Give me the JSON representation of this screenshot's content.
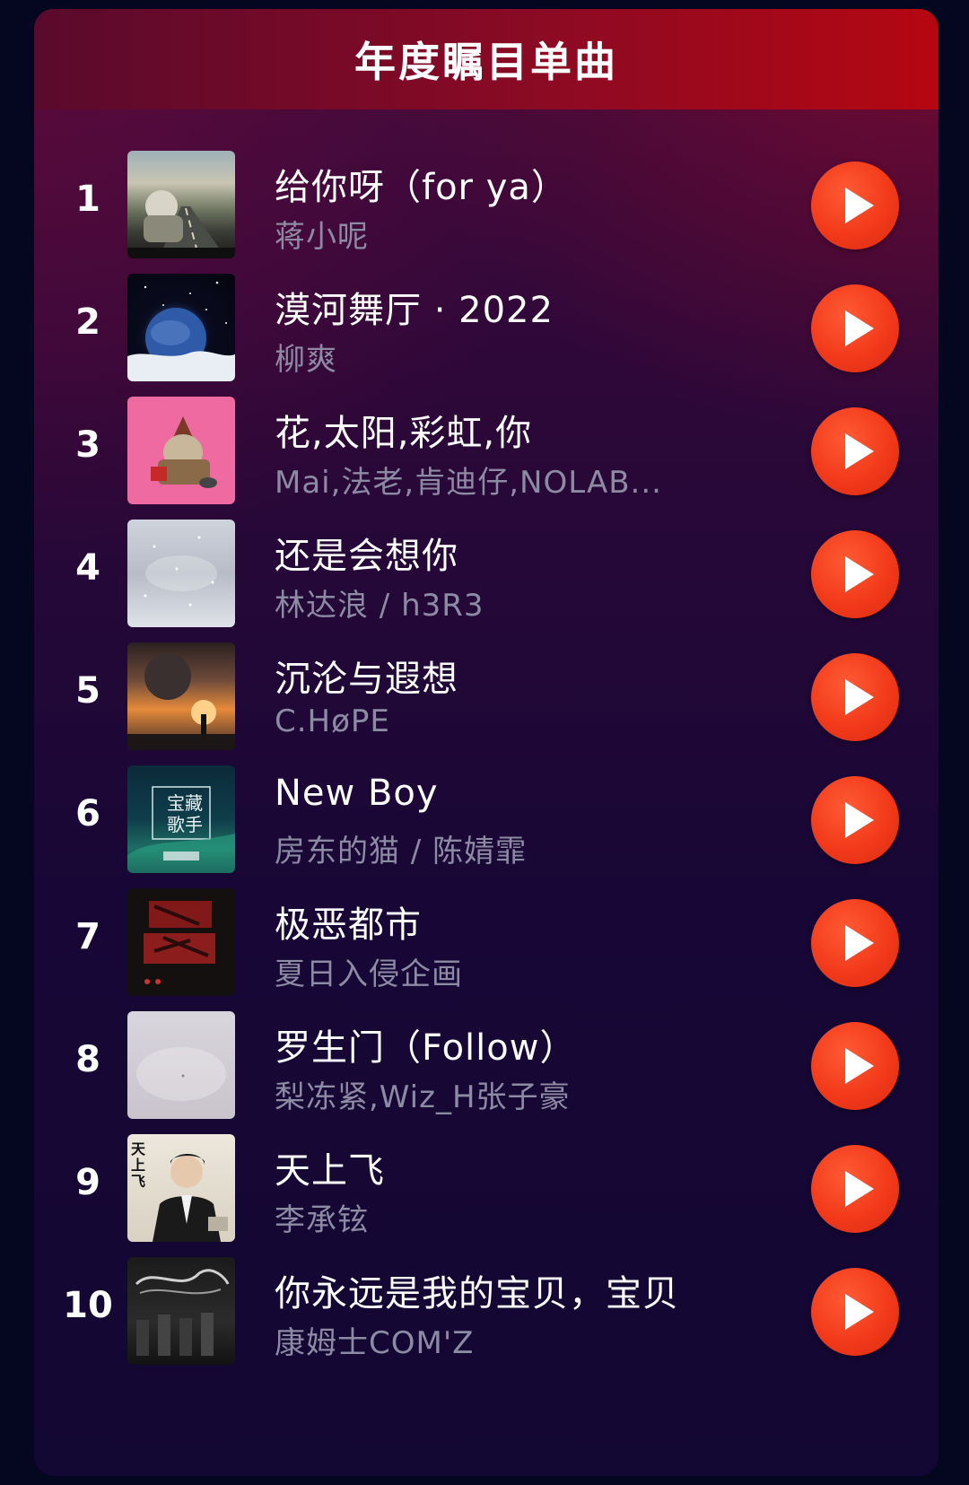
{
  "header": {
    "title": "年度瞩目单曲"
  },
  "accent": {
    "play_button": "#f23a1a",
    "header_gradient_end": "#b50712",
    "card_background": "#2a0838"
  },
  "songs": [
    {
      "rank": "1",
      "title": "给你呀（for ya）",
      "artist": "蒋小呢",
      "cover_icon": "road-scene-cover"
    },
    {
      "rank": "2",
      "title": "漠河舞厅 · 2022",
      "artist": "柳爽",
      "cover_icon": "planet-cover"
    },
    {
      "rank": "3",
      "title": "花,太阳,彩虹,你",
      "artist": "Mai,法老,肯迪仔,NOLAB...",
      "cover_icon": "pink-character-cover"
    },
    {
      "rank": "4",
      "title": "还是会想你",
      "artist": "林达浪 / h3R3",
      "cover_icon": "snowy-sky-cover"
    },
    {
      "rank": "5",
      "title": "沉沦与遐想",
      "artist": "C.HøPE",
      "cover_icon": "sunset-figure-cover"
    },
    {
      "rank": "6",
      "title": "New Boy",
      "artist": "房东的猫 / 陈婧霏",
      "cover_icon": "treasure-singer-cover",
      "cover_text": [
        "宝藏",
        "歌手"
      ]
    },
    {
      "rank": "7",
      "title": "极恶都市",
      "artist": "夏日入侵企画",
      "cover_icon": "red-calligraphy-cover"
    },
    {
      "rank": "8",
      "title": "罗生门（Follow）",
      "artist": "梨冻紧,Wiz_H张子豪",
      "cover_icon": "misty-grey-cover"
    },
    {
      "rank": "9",
      "title": "天上飞",
      "artist": "李承铉",
      "cover_icon": "portrait-cover",
      "cover_text": [
        "天",
        "上",
        "飞"
      ]
    },
    {
      "rank": "10",
      "title": "你永远是我的宝贝，宝贝",
      "artist": "康姆士COM'Z",
      "cover_icon": "dark-band-cover"
    }
  ]
}
